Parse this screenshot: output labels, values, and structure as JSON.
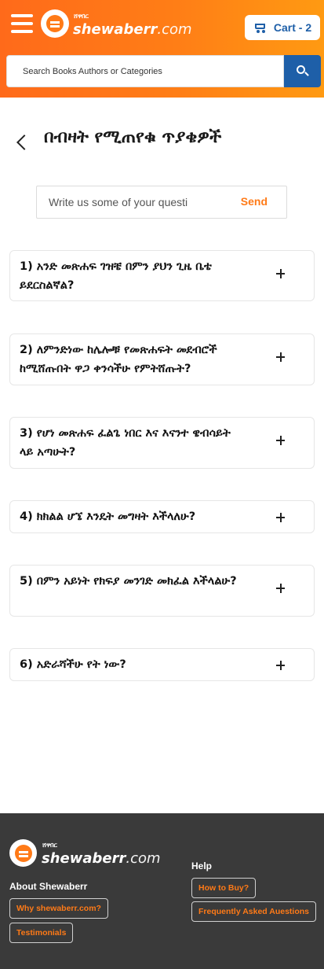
{
  "header": {
    "brand_small": "ሸዋበር",
    "brand_name": "shewaberr",
    "brand_tld": ".com",
    "cart_label": "Cart - 2",
    "search_placeholder": "Search Books Authors or Categories"
  },
  "page": {
    "title": "በብዛት የሚጠየቁ ጥያቄዎች"
  },
  "ask_form": {
    "placeholder": "Write us some of your questi",
    "send_label": "Send"
  },
  "faq": [
    {
      "question": "1) አንድ መጽሐፍ ገዝቼ በምን ያህን ጊዜ ቤቴ ይደርስልኛል?"
    },
    {
      "question": "2) ለምንድነው ከሌሎቹ የመጽሐፍት መደብሮች ከሚሸጡበት ዋጋ ቀንሳችሁ የምትሸጡት?"
    },
    {
      "question": "3) የሆነ መጽሐፍ ፈልጌ ነበር እና እናንተ ዌብሳይት ላይ አጣሁት?"
    },
    {
      "question": "4) ክክልል ሆኜ እንዴት መግዛት እችላለሁ?"
    },
    {
      "question": "5) በምን አይነት የክፍያ መንገድ መክፈል እችላልሁ?"
    },
    {
      "question": "6) አድራሻችሁ የት ነው?"
    }
  ],
  "footer": {
    "brand_small": "ሸዋበር",
    "brand_name": "shewaberr",
    "brand_tld": ".com",
    "about_heading": "About Shewaberr",
    "help_heading": "Help",
    "links_about": [
      "Why shewaberr.com?",
      "Testimonials"
    ],
    "links_help": [
      "How to Buy?",
      "Frequently Asked Auestions"
    ]
  },
  "colors": {
    "brand_orange": "#ff7a17",
    "accent_blue": "#1e5fa8",
    "footer_bg": "#3a3a3a"
  },
  "icons": [
    "menu-icon",
    "cart-icon",
    "search-icon",
    "back-arrow-icon",
    "plus-icon"
  ]
}
